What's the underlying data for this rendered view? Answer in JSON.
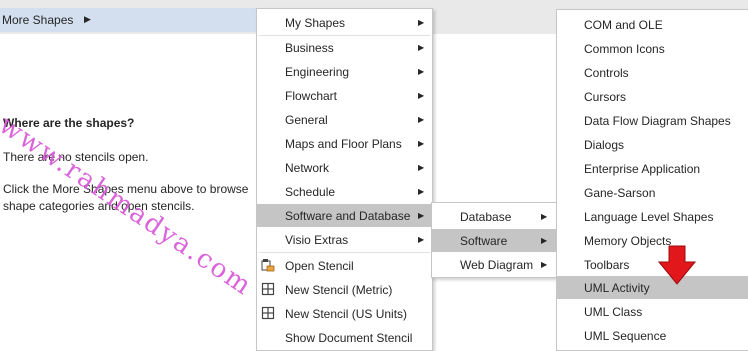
{
  "left_pane": {
    "more_shapes_label": "More Shapes",
    "where_title": "Where are the shapes?",
    "no_stencils": "There are no stencils open.",
    "hint_line1": "Click the More Shapes menu above to browse",
    "hint_line2": "shape categories and open stencils."
  },
  "menu1": {
    "items": [
      {
        "label": "My Shapes",
        "has_submenu": true
      },
      {
        "label": "Business",
        "has_submenu": true
      },
      {
        "label": "Engineering",
        "has_submenu": true
      },
      {
        "label": "Flowchart",
        "has_submenu": true
      },
      {
        "label": "General",
        "has_submenu": true
      },
      {
        "label": "Maps and Floor Plans",
        "has_submenu": true
      },
      {
        "label": "Network",
        "has_submenu": true
      },
      {
        "label": "Schedule",
        "has_submenu": true
      },
      {
        "label": "Software and Database",
        "has_submenu": true,
        "selected": true
      },
      {
        "label": "Visio Extras",
        "has_submenu": true
      },
      {
        "label": "Open Stencil",
        "icon": "open-stencil-icon"
      },
      {
        "label": "New Stencil (Metric)",
        "icon": "new-stencil-icon"
      },
      {
        "label": "New Stencil (US Units)",
        "icon": "new-stencil-icon"
      },
      {
        "label": "Show Document Stencil"
      }
    ]
  },
  "menu2": {
    "items": [
      {
        "label": "Database",
        "has_submenu": true
      },
      {
        "label": "Software",
        "has_submenu": true,
        "selected": true
      },
      {
        "label": "Web Diagram",
        "has_submenu": true
      }
    ]
  },
  "menu3": {
    "items": [
      {
        "label": "COM and OLE"
      },
      {
        "label": "Common Icons"
      },
      {
        "label": "Controls"
      },
      {
        "label": "Cursors"
      },
      {
        "label": "Data Flow Diagram Shapes"
      },
      {
        "label": "Dialogs"
      },
      {
        "label": "Enterprise Application"
      },
      {
        "label": "Gane-Sarson"
      },
      {
        "label": "Language Level Shapes"
      },
      {
        "label": "Memory Objects"
      },
      {
        "label": "Toolbars"
      },
      {
        "label": "UML Activity",
        "selected": true
      },
      {
        "label": "UML Class"
      },
      {
        "label": "UML Sequence"
      }
    ]
  },
  "watermark": "www.rahmadya.com",
  "colors": {
    "selected": "#c5c5c5",
    "more_shapes_bg": "#d3deee",
    "arrow": "#e2171b",
    "watermark": "#d95cd9"
  }
}
